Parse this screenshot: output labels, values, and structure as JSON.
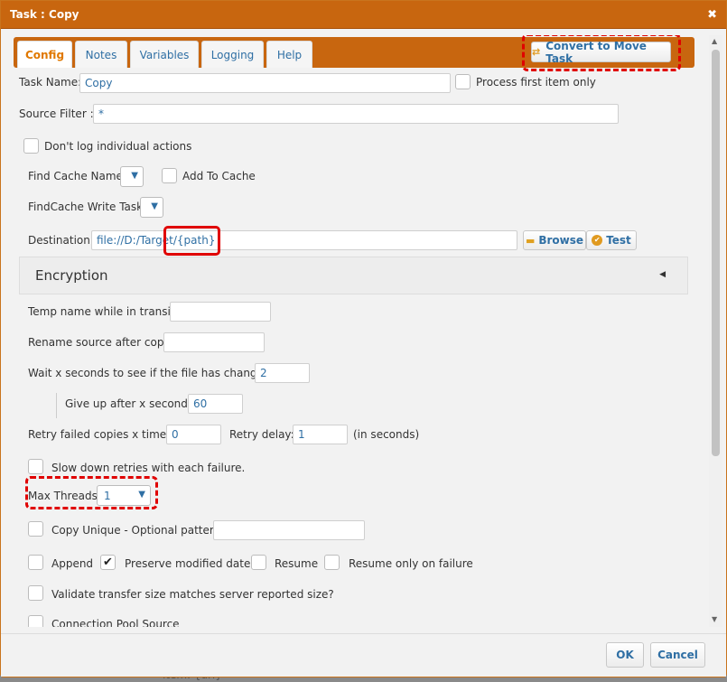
{
  "dialog": {
    "title": "Task : Copy",
    "close_glyph": "✖"
  },
  "tabs": [
    {
      "label": "Config",
      "active": true
    },
    {
      "label": "Notes",
      "active": false
    },
    {
      "label": "Variables",
      "active": false
    },
    {
      "label": "Logging",
      "active": false
    },
    {
      "label": "Help",
      "active": false
    }
  ],
  "convert_button": {
    "label": "Convert to Move Task",
    "icon": "exchange-icon"
  },
  "task_name": {
    "label": "Task Name:",
    "value": "Copy"
  },
  "process_first": {
    "label": "Process first item only",
    "checked": false
  },
  "source_filter": {
    "label": "Source Filter :",
    "value": "*"
  },
  "dont_log": {
    "label": "Don't log individual actions",
    "checked": false
  },
  "find_cache": {
    "label": "Find Cache Name:",
    "value": ""
  },
  "add_to_cache": {
    "label": "Add To Cache",
    "checked": false
  },
  "findcache_write": {
    "label": "FindCache Write Task:",
    "value": ""
  },
  "destination": {
    "label": "Destination:",
    "value": "file://D:/Target/{path}",
    "browse_label": "Browse",
    "test_label": "Test"
  },
  "encryption": {
    "title": "Encryption",
    "caret": "◀"
  },
  "temp_name": {
    "label": "Temp name while in transit:",
    "value": ""
  },
  "rename_source": {
    "label": "Rename source after copy:",
    "value": ""
  },
  "wait_seconds": {
    "label": "Wait x seconds to see if the file has changed:",
    "value": "2"
  },
  "give_up": {
    "label": "Give up after x seconds:",
    "value": "60"
  },
  "retry_copies": {
    "label": "Retry failed copies x times:",
    "value": "0"
  },
  "retry_delay": {
    "label": "Retry delay:",
    "value": "1",
    "unit": "(in seconds)"
  },
  "slow_down": {
    "label": "Slow down retries with each failure.",
    "checked": false
  },
  "max_threads": {
    "label": "Max Threads:",
    "value": "1"
  },
  "copy_unique": {
    "label": "Copy Unique - Optional pattern:",
    "value": ""
  },
  "append": {
    "label": "Append",
    "checked": false
  },
  "preserve_date": {
    "label": "Preserve modified date",
    "checked": true
  },
  "resume": {
    "label": "Resume",
    "checked": false
  },
  "resume_failure": {
    "label": "Resume only on failure",
    "checked": false
  },
  "validate_size": {
    "label": "Validate transfer size matches server reported size?",
    "checked": false
  },
  "connection_pool": {
    "label": "Connection Pool Source",
    "checked": false
  },
  "footer": {
    "ok_label": "OK",
    "cancel_label": "Cancel"
  },
  "backdrop": {
    "text": "item. {url}"
  },
  "colors": {
    "accent": "#c8660f",
    "link": "#2f6fa4",
    "highlight": "#e00000",
    "tab_active": "#e07800"
  }
}
